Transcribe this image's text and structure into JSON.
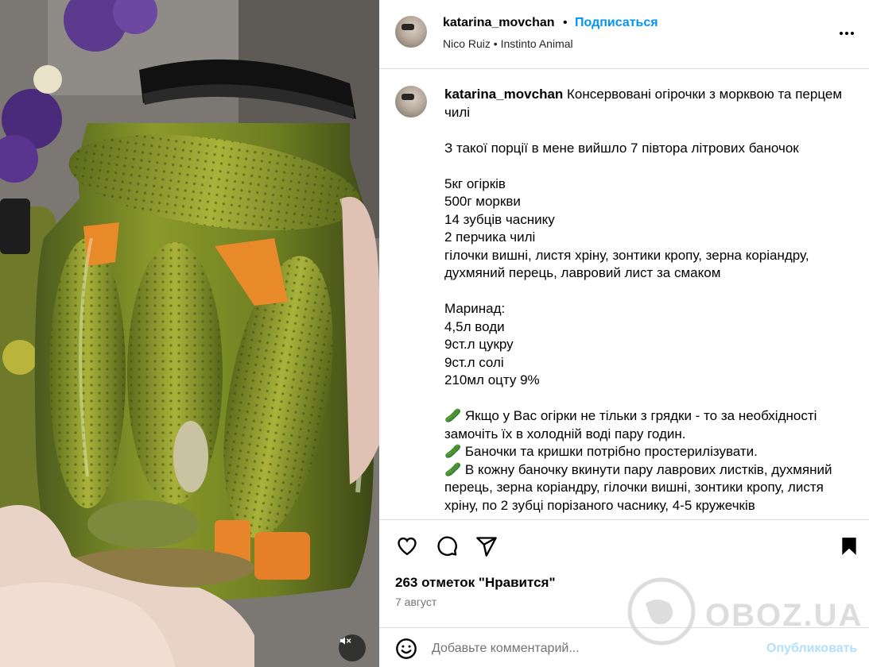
{
  "post": {
    "username": "katarina_movchan",
    "separator": "•",
    "follow_label": "Подписаться",
    "audio": "Nico Ruiz • Instinto Animal",
    "more_icon": "more-options-icon"
  },
  "caption": {
    "username": "katarina_movchan",
    "text": " Консервовані огірочки з морквою та перцем чилі\n\nЗ такої порції в мене вийшло 7 півтора літрових баночок\n\n5кг огірків\n500г моркви\n14 зубців часнику\n2 перчика чилі\nгілочки вишні, листя хріну, зонтики кропу, зерна коріандру, духмяний перець, лавровий лист за смаком\n\nМаринад:\n4,5л води\n9ст.л цукру\n9ст.л солі\n210мл оцту 9%\n\n🥒 Якщо у Вас огірки не тільки з грядки - то за необхідності замочіть їх в холодній воді пару годин.\n🥒 Баночки та кришки потрібно простерилізувати.\n🥒 В кожну баночку вкинути пару лаврових листків, духмяний перець, зерна коріандру, гілочки вишні, зонтики кропу, листя хріну, по 2 зубці порізаного часнику, 4-5 кружечків"
  },
  "stats": {
    "likes": "263 отметок \"Нравится\"",
    "date": "7 август"
  },
  "comment_box": {
    "placeholder": "Добавьте комментарий...",
    "publish_label": "Опубликовать"
  },
  "watermark": {
    "text": "OBOZ.UA"
  },
  "icons": {
    "like": "heart-icon",
    "comment": "comment-icon",
    "share": "share-icon",
    "save": "bookmark-icon",
    "emoji": "emoji-icon",
    "mute": "muted-speaker-icon"
  }
}
